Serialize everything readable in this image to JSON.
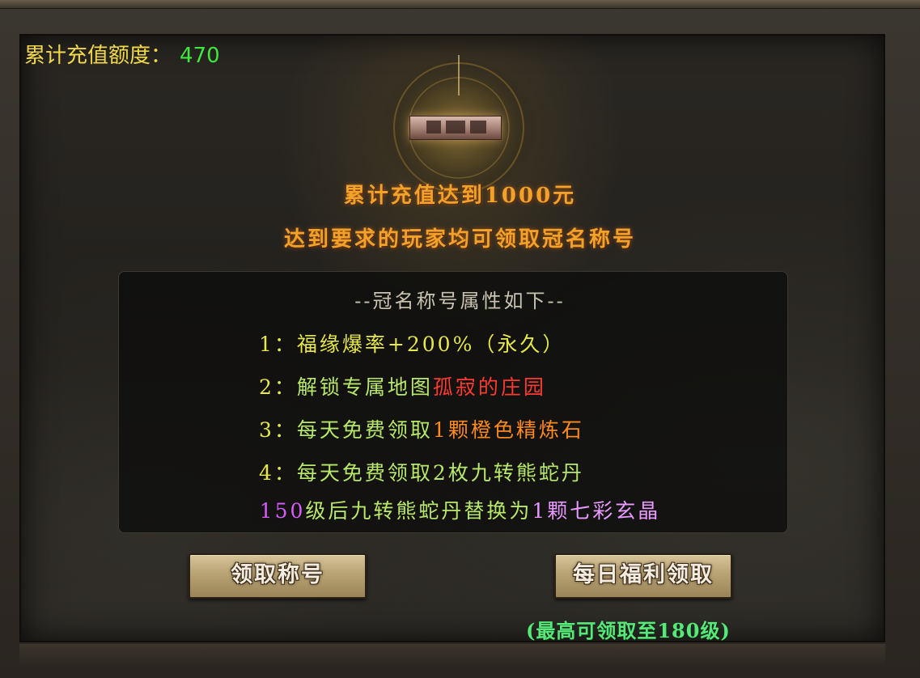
{
  "recharge": {
    "label": "累计充值额度：",
    "value": "470"
  },
  "emblem": {
    "icon": "title-badge-icon"
  },
  "headline": {
    "line1": "累计充值达到1000元",
    "line2": "达到要求的玩家均可领取冠名称号"
  },
  "attributes": {
    "title": "--冠名称号属性如下--",
    "items": [
      {
        "num": "1：",
        "text": "福缘爆率+200%（永久）"
      },
      {
        "num": "2：",
        "text": "解锁专属地图",
        "highlight": "孤寂的庄园"
      },
      {
        "num": "3：",
        "text": "每天免费领取",
        "highlight": "1颗橙色精炼石"
      },
      {
        "num": "4：",
        "text": "每天免费领取2枚九转熊蛇丹"
      }
    ],
    "line5": {
      "p1": "150",
      "p2": "级后九转熊蛇丹替换为",
      "p3": "1颗七彩玄晶"
    }
  },
  "buttons": {
    "claim_title": "领取称号",
    "daily_claim": "每日福利领取"
  },
  "note": "(最高可领取至180级)",
  "colors": {
    "label_yellow": "#f2d94a",
    "value_green": "#3ee63e",
    "headline_orange": "#f0a22a",
    "attr_green": "#b8e86a",
    "map_red": "#ff3b2f",
    "item_orange": "#ff8a1e",
    "purple": "#d65cff",
    "note_green": "#58e87a"
  }
}
